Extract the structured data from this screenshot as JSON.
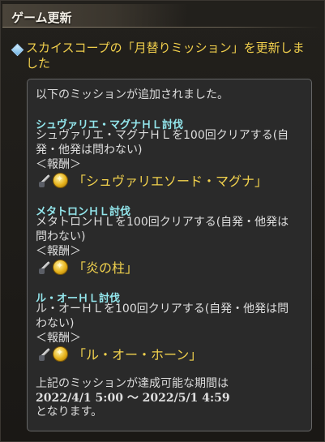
{
  "header": {
    "title": "ゲーム更新"
  },
  "intro": "スカイスコープの「月替りミッション」を更新しました",
  "box": {
    "lead": "以下のミッションが追加されました。",
    "missions": [
      {
        "title": "シュヴァリエ・マグナＨＬ討伐",
        "desc_line1": "シュヴァリエ・マグナＨＬを100回クリアする(自",
        "desc_line2": "発・他発は問わない)",
        "reward_label": "＜報酬＞",
        "reward_name": "「シュヴァリエソード・マグナ」"
      },
      {
        "title": "メタトロンＨＬ討伐",
        "desc_line1": "メタトロンＨＬを100回クリアする(自発・他発は",
        "desc_line2": "問わない)",
        "reward_label": "＜報酬＞",
        "reward_name": "「炎の柱」"
      },
      {
        "title": "ル・オーＨＬ討伐",
        "desc_line1": "ル・オーＨＬを100回クリアする(自発・他発は問",
        "desc_line2": "わない)",
        "reward_label": "＜報酬＞",
        "reward_name": "「ル・オー・ホーン」"
      }
    ],
    "period_line1": "上記のミッションが達成可能な期間は",
    "period_line2": "2022/4/1 5:00 ～ 2022/5/1 4:59",
    "period_line3": "となります。"
  },
  "icons": [
    "sword-icon",
    "coin-icon",
    "diamond-bullet-icon"
  ]
}
